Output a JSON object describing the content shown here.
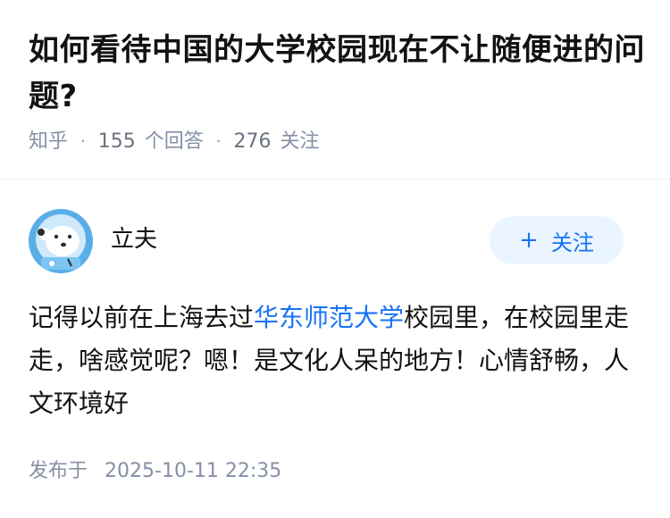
{
  "question": {
    "title": "如何看待中国的大学校园现在不让随便进的问题?",
    "source": "知乎",
    "answer_count": "155",
    "answer_label": "个回答",
    "follower_count": "276",
    "follower_label": "关注"
  },
  "answer": {
    "author_name": "立夫",
    "follow_label": "关注",
    "follow_icon": "plus-icon",
    "body_before_link": "记得以前在上海去过",
    "body_link": "华东师范大学",
    "body_after_link": "校园里，在校园里走走，啥感觉呢？嗯！是文化人呆的地方！心情舒畅，人文环境好",
    "publish_label": "发布于",
    "publish_time": "2025-10-11 22:35"
  },
  "colors": {
    "link": "#1772f6",
    "follow_bg": "#ebf5ff",
    "meta_text": "#8590a6",
    "avatar_bg": "#5aaee8"
  }
}
